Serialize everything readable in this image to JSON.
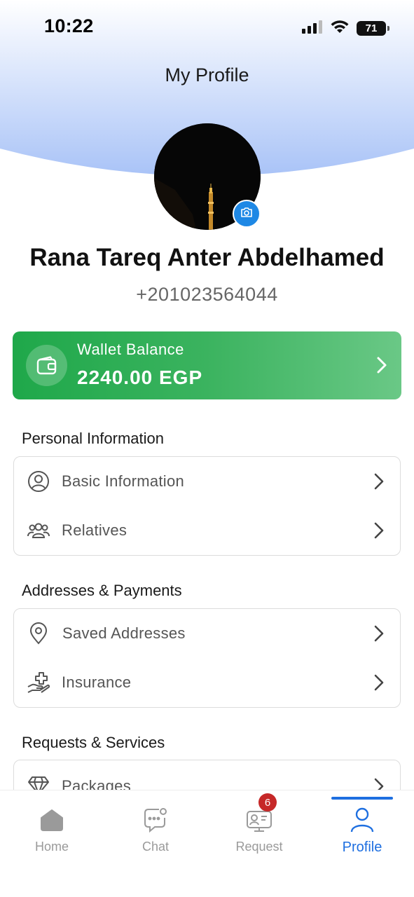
{
  "status_bar": {
    "time": "10:22",
    "battery": "71"
  },
  "header": {
    "title": "My Profile"
  },
  "profile": {
    "name": "Rana Tareq Anter Abdelhamed",
    "phone": "+201023564044"
  },
  "wallet": {
    "label": "Wallet Balance",
    "amount": "2240.00 EGP"
  },
  "sections": {
    "personal": {
      "title": "Personal Information",
      "items": [
        {
          "label": "Basic Information",
          "icon": "user-circle-icon"
        },
        {
          "label": "Relatives",
          "icon": "group-icon"
        }
      ]
    },
    "addresses": {
      "title": "Addresses & Payments",
      "items": [
        {
          "label": "Saved Addresses",
          "icon": "location-pin-icon"
        },
        {
          "label": "Insurance",
          "icon": "hand-plus-icon"
        }
      ]
    },
    "requests": {
      "title": "Requests & Services",
      "items": [
        {
          "label": "Packages",
          "icon": "diamond-icon"
        }
      ]
    }
  },
  "tabbar": {
    "items": [
      {
        "label": "Home",
        "icon": "home-icon"
      },
      {
        "label": "Chat",
        "icon": "chat-icon"
      },
      {
        "label": "Request",
        "icon": "request-icon",
        "badge": "6"
      },
      {
        "label": "Profile",
        "icon": "profile-icon",
        "active": true
      }
    ]
  },
  "colors": {
    "accent": "#1e6fe0",
    "wallet_green": "#1fa84a",
    "badge_red": "#c62828",
    "header_blue": "#a9c3f7"
  }
}
